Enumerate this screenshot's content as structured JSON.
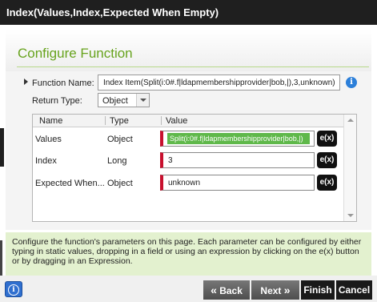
{
  "window": {
    "title": "Index(Values,Index,Expected When Empty)"
  },
  "header": {
    "title": "Configure Function"
  },
  "form": {
    "function_name_label": "Function Name:",
    "function_name_value": "Index Item(Split(i:0#.f|ldapmembershipprovider|bob,|),3,unknown)",
    "return_type_label": "Return Type:",
    "return_type_value": "Object"
  },
  "grid": {
    "columns": [
      "Name",
      "Type",
      "Value"
    ],
    "rows": [
      {
        "name": "Values",
        "type": "Object",
        "value": "Split(i:0#.f|ldapmembershipprovider|bob,|)",
        "expr_label": "e(x)"
      },
      {
        "name": "Index",
        "type": "Long",
        "value": "3",
        "expr_label": "e(x)"
      },
      {
        "name": "Expected When...",
        "type": "Object",
        "value": "unknown",
        "expr_label": "e(x)"
      }
    ]
  },
  "help": {
    "text": "Configure the function's parameters on this page.  Each parameter can be configured by either typing in static values, dropping in a field or using an expression by clicking on the e(x) button or by dragging in an Expression."
  },
  "footer": {
    "back_label": "Back",
    "next_label": "Next",
    "finish_label": "Finish",
    "cancel_label": "Cancel"
  },
  "icons": {
    "info": "i",
    "chevron_back": "«",
    "chevron_next": "»"
  },
  "colors": {
    "accent_green": "#67a31d",
    "required_red": "#c8102e",
    "chip_green": "#5fb84a",
    "info_blue": "#2c7fd9"
  }
}
